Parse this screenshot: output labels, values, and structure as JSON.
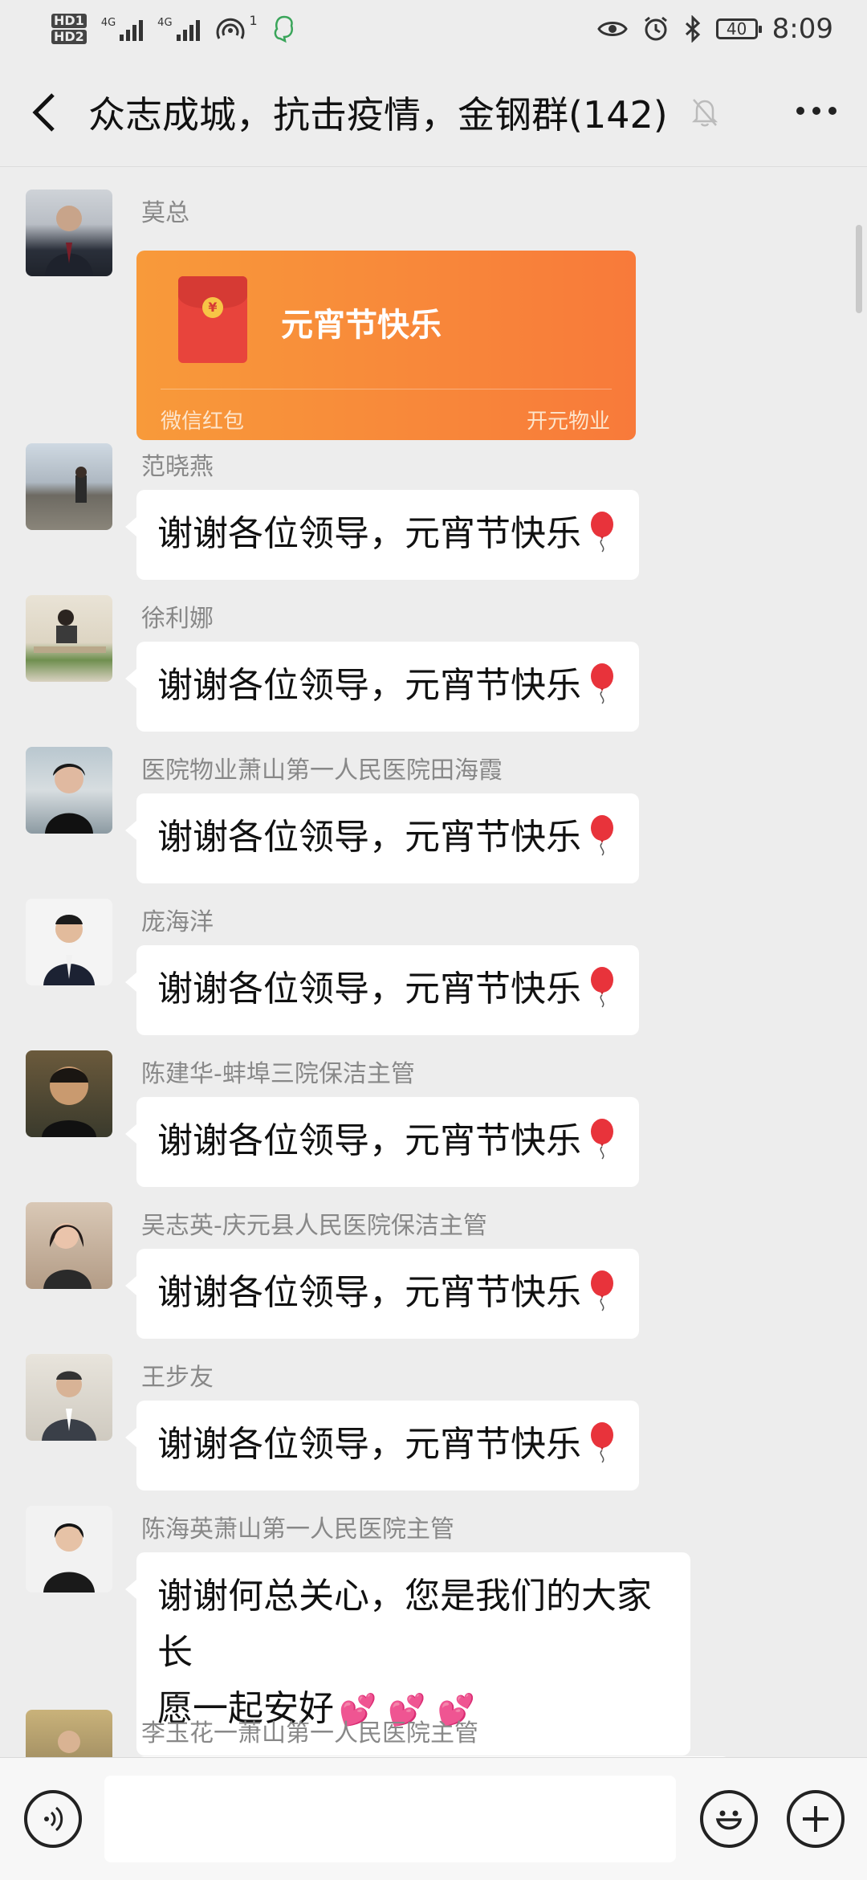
{
  "status_bar": {
    "hd1": "HD1",
    "hd2": "HD2",
    "net1": "4G",
    "net2": "4G",
    "hotspot_count": "1",
    "battery": "40",
    "time": "8:09"
  },
  "header": {
    "title": "众志成城，抗击疫情，金钢群(142)"
  },
  "red_packet": {
    "sender": "莫总",
    "title": "元宵节快乐",
    "footer_left": "微信红包",
    "footer_right": "开元物业",
    "coin_symbol": "¥"
  },
  "messages": [
    {
      "sender": "范晓燕",
      "text": "谢谢各位领导，元宵节快乐"
    },
    {
      "sender": "徐利娜",
      "text": "谢谢各位领导，元宵节快乐"
    },
    {
      "sender": "医院物业萧山第一人民医院田海霞",
      "text": "谢谢各位领导，元宵节快乐"
    },
    {
      "sender": "庞海洋",
      "text": "谢谢各位领导，元宵节快乐"
    },
    {
      "sender": "陈建华-蚌埠三院保洁主管",
      "text": "谢谢各位领导，元宵节快乐"
    },
    {
      "sender": "吴志英-庆元县人民医院保洁主管",
      "text": "谢谢各位领导，元宵节快乐"
    },
    {
      "sender": "王步友",
      "text": "谢谢各位领导，元宵节快乐"
    }
  ],
  "long_message": {
    "sender": "陈海英萧山第一人民医院主管",
    "line1": "谢谢何总关心，您是我们的大家长",
    "line2": "愿一起安好",
    "emoji": "💕"
  },
  "last_sender": "李玉花一萧山第一人民医院主管",
  "input": {
    "value": "",
    "placeholder": ""
  },
  "icons": {
    "back": "chevron-left-icon",
    "mute": "bell-off-icon",
    "more": "more-dots-icon",
    "balloon": "balloon-icon",
    "voice": "voice-icon",
    "emoji": "emoji-icon",
    "plus": "plus-icon"
  },
  "colors": {
    "background": "#ededed",
    "bubble": "#ffffff",
    "red_packet": "#f88a3a",
    "balloon": "#e8333b"
  }
}
